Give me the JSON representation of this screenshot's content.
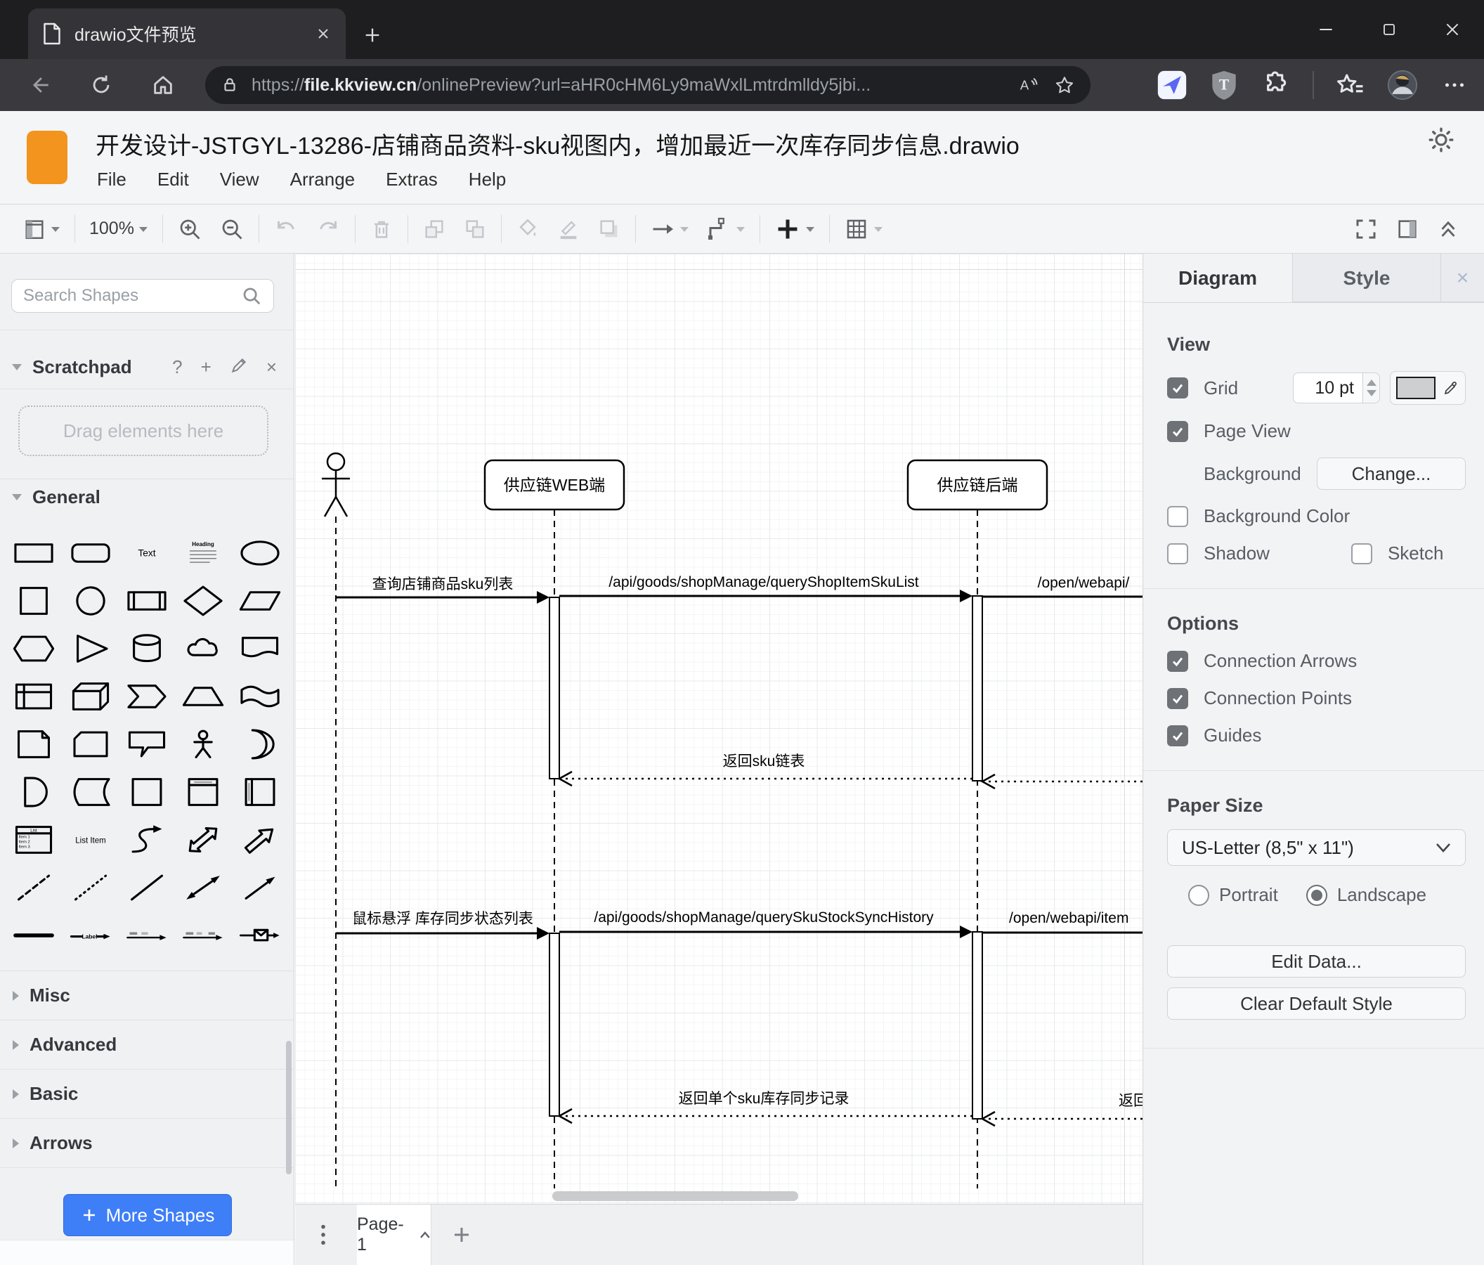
{
  "browser": {
    "tab_title": "drawio文件预览",
    "url_scheme": "https://",
    "url_domain": "file.kkview.cn",
    "url_path": "/onlinePreview?url=aHR0cHM6Ly9maWxlLmtrdmlldy5jbi..."
  },
  "app": {
    "title": "开发设计-JSTGYL-13286-店铺商品资料-sku视图内，增加最近一次库存同步信息.drawio",
    "menus": [
      "File",
      "Edit",
      "View",
      "Arrange",
      "Extras",
      "Help"
    ],
    "zoom": "100%"
  },
  "sidebar": {
    "search_placeholder": "Search Shapes",
    "scratchpad_title": "Scratchpad",
    "scratchpad_icons": {
      "help": "?",
      "add": "+",
      "close": "×"
    },
    "drag_hint": "Drag elements here",
    "sections": {
      "general": "General",
      "misc": "Misc",
      "advanced": "Advanced",
      "basic": "Basic",
      "arrows": "Arrows"
    },
    "more_shapes": "More Shapes",
    "shapes": [
      {
        "name": "rectangle"
      },
      {
        "name": "rounded-rectangle"
      },
      {
        "name": "text",
        "label": "Text"
      },
      {
        "name": "textbox",
        "label": "Heading"
      },
      {
        "name": "ellipse"
      },
      {
        "name": "square"
      },
      {
        "name": "circle"
      },
      {
        "name": "process"
      },
      {
        "name": "diamond"
      },
      {
        "name": "parallelogram"
      },
      {
        "name": "hexagon"
      },
      {
        "name": "triangle"
      },
      {
        "name": "cylinder"
      },
      {
        "name": "cloud"
      },
      {
        "name": "document"
      },
      {
        "name": "internal-storage"
      },
      {
        "name": "cube"
      },
      {
        "name": "step"
      },
      {
        "name": "trapezoid"
      },
      {
        "name": "tape"
      },
      {
        "name": "note"
      },
      {
        "name": "card"
      },
      {
        "name": "callout"
      },
      {
        "name": "actor"
      },
      {
        "name": "or"
      },
      {
        "name": "and"
      },
      {
        "name": "data-storage"
      },
      {
        "name": "container"
      },
      {
        "name": "vertical-container"
      },
      {
        "name": "horizontal-container"
      },
      {
        "name": "list",
        "label": "List",
        "items": [
          "Item 1",
          "Item 2",
          "Item 3"
        ]
      },
      {
        "name": "list-item",
        "label": "List Item"
      },
      {
        "name": "curve"
      },
      {
        "name": "bidirectional-arrow"
      },
      {
        "name": "arrow"
      },
      {
        "name": "dashed-line"
      },
      {
        "name": "dotted-line"
      },
      {
        "name": "line"
      },
      {
        "name": "bidirectional-connector"
      },
      {
        "name": "directional-connector"
      },
      {
        "name": "horizontal-line"
      },
      {
        "name": "label-arrow",
        "label": "Label"
      },
      {
        "name": "link"
      },
      {
        "name": "link-edge"
      },
      {
        "name": "mail-connector"
      }
    ]
  },
  "diagram": {
    "participants": [
      {
        "label": "供应链WEB端"
      },
      {
        "label": "供应链后端"
      }
    ],
    "messages": {
      "query_sku_list": "查询店铺商品sku列表",
      "api_query_shop_item_sku_list": "/api/goods/shopManage/queryShopItemSkuList",
      "open_webapi": "/open/webapi/",
      "return_sku_list": "返回sku链表",
      "hover_stock_sync": "鼠标悬浮 库存同步状态列表",
      "api_query_sku_stock_sync_history": "/api/goods/shopManage/querySkuStockSyncHistory",
      "open_webapi_item": "/open/webapi/item",
      "return_single_sku": "返回单个sku库存同步记录",
      "return_partial": "返回"
    }
  },
  "footer": {
    "page_tab": "Page-1"
  },
  "panel": {
    "tab_diagram": "Diagram",
    "tab_style": "Style",
    "close": "×",
    "view": {
      "heading": "View",
      "grid": "Grid",
      "grid_size": "10 pt",
      "page_view": "Page View",
      "background": "Background",
      "change_button": "Change...",
      "background_color": "Background Color",
      "shadow": "Shadow",
      "sketch": "Sketch"
    },
    "options": {
      "heading": "Options",
      "connection_arrows": "Connection Arrows",
      "connection_points": "Connection Points",
      "guides": "Guides"
    },
    "paper": {
      "heading": "Paper Size",
      "size_value": "US-Letter (8,5\" x 11\")",
      "portrait": "Portrait",
      "landscape": "Landscape"
    },
    "edit_data": "Edit Data...",
    "clear_default_style": "Clear Default Style"
  },
  "colors": {
    "accent_blue": "#3e7ef7",
    "logo_orange": "#f2941e",
    "grid_swatch": "#cdcfd1"
  }
}
